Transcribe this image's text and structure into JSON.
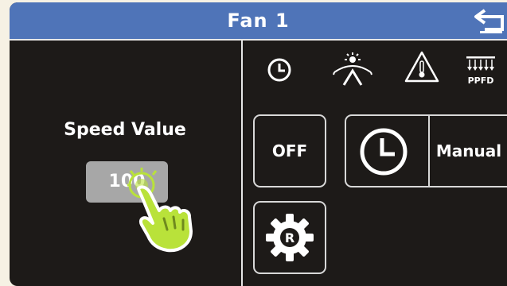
{
  "header": {
    "title": "Fan 1",
    "back_icon": "back-arrow-icon"
  },
  "left_panel": {
    "speed_label": "Speed Value",
    "speed_value": "100"
  },
  "status_icons": [
    {
      "name": "clock-icon"
    },
    {
      "name": "sunrise-icon"
    },
    {
      "name": "temperature-warning-icon"
    },
    {
      "name": "ppfd-icon",
      "label": "PPFD"
    }
  ],
  "buttons": {
    "off_label": "OFF",
    "mode_label": "Manual"
  },
  "colors": {
    "header": "#4f74b8",
    "background": "#1d1a18",
    "hand_accent": "#b9e23a"
  }
}
